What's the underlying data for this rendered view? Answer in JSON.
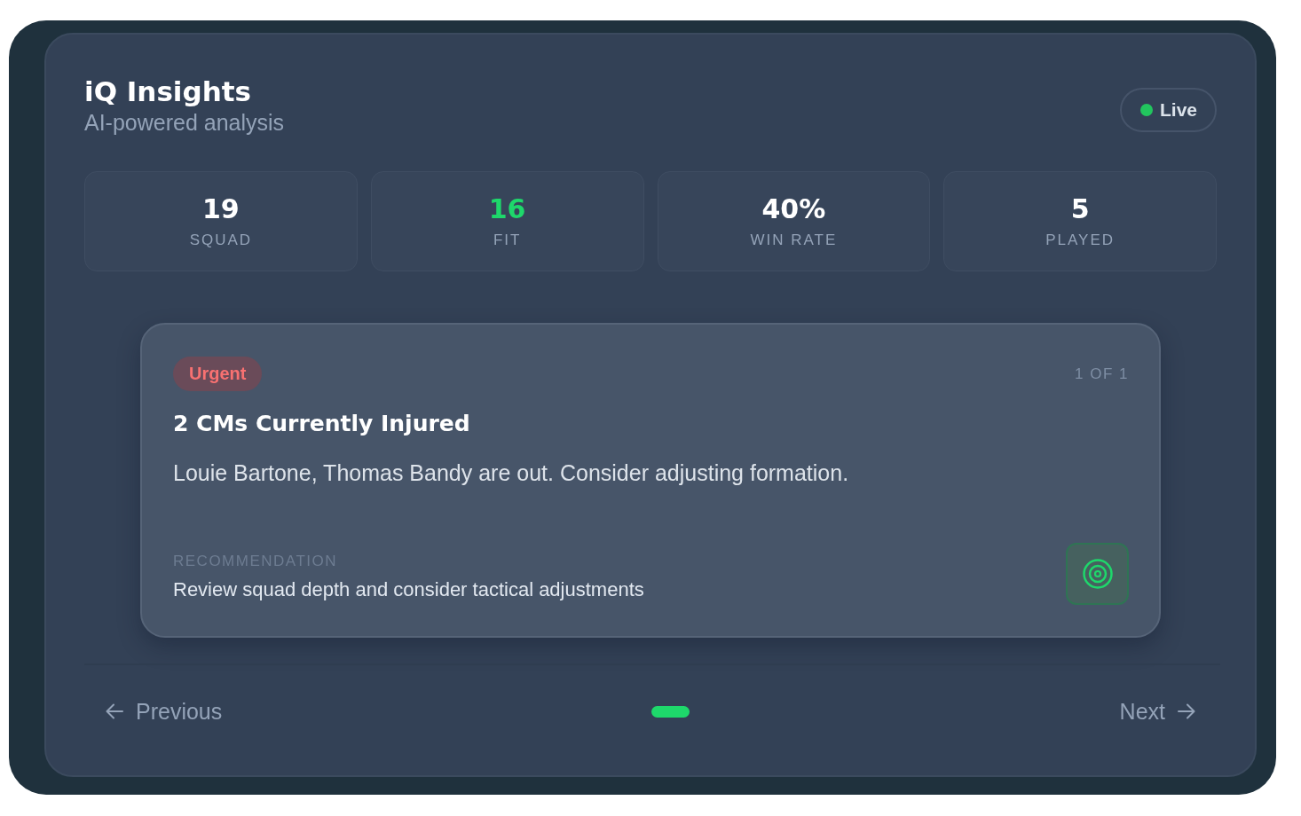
{
  "header": {
    "title": "iQ Insights",
    "subtitle": "AI-powered analysis",
    "status": {
      "label": "Live",
      "on": true
    }
  },
  "stats": [
    {
      "value": "19",
      "label": "SQUAD",
      "color": "#ffffff"
    },
    {
      "value": "16",
      "label": "FIT",
      "color": "#1ed86b"
    },
    {
      "value": "40%",
      "label": "WIN RATE",
      "color": "#ffffff"
    },
    {
      "value": "5",
      "label": "PLAYED",
      "color": "#ffffff"
    }
  ],
  "insight": {
    "badge": {
      "label": "Urgent",
      "kind": "urgent"
    },
    "counter": "1 OF 1",
    "title": "2 CMs Currently Injured",
    "body": "Louie Bartone, Thomas Bandy are out. Consider adjusting formation.",
    "recommendation_label": "RECOMMENDATION",
    "recommendation": "Review squad depth and consider tactical adjustments"
  },
  "pagination": {
    "previous": "Previous",
    "next": "Next",
    "dots": [
      {
        "selected": true
      }
    ]
  }
}
